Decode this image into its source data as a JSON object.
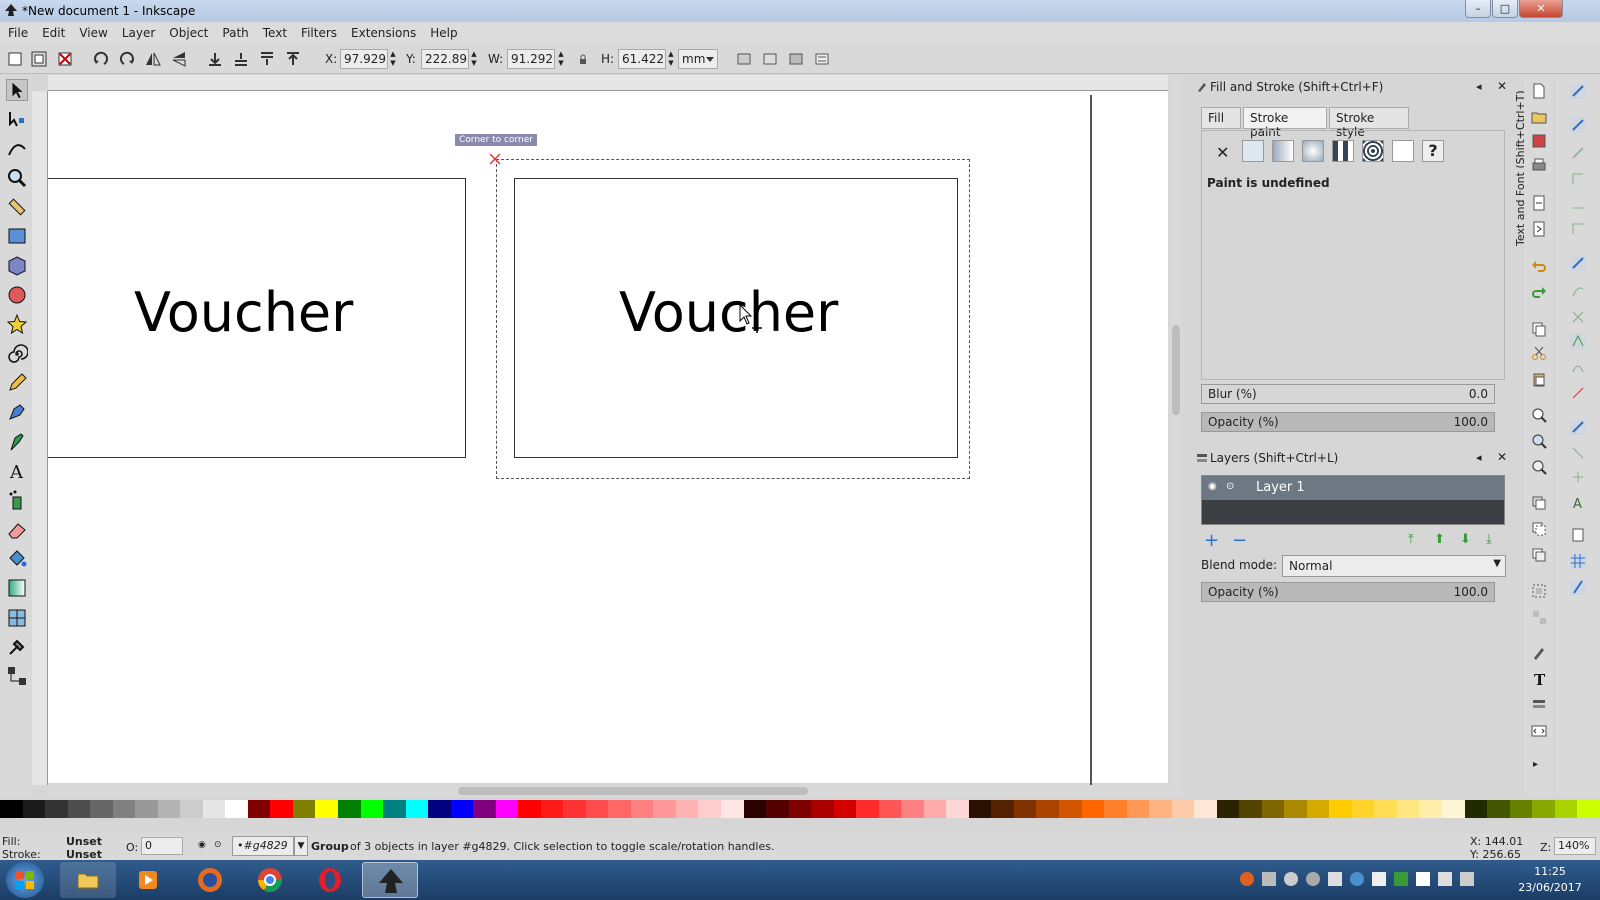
{
  "window": {
    "title": "*New document 1 - Inkscape",
    "minimize": "–",
    "maximize": "□",
    "close": "✕"
  },
  "menu": [
    "File",
    "Edit",
    "View",
    "Layer",
    "Object",
    "Path",
    "Text",
    "Filters",
    "Extensions",
    "Help"
  ],
  "toolbar": {
    "x_label": "X:",
    "x_value": "97.929",
    "y_label": "Y:",
    "y_value": "222.895",
    "w_label": "W:",
    "w_value": "91.292",
    "h_label": "H:",
    "h_value": "61.422",
    "unit": "mm"
  },
  "canvas": {
    "snap_tooltip": "Corner to corner",
    "left_card_text": "Voucher",
    "right_card_text": "Voucher"
  },
  "fill_stroke": {
    "title": "Fill and Stroke (Shift+Ctrl+F)",
    "tabs": [
      "Fill",
      "Stroke paint",
      "Stroke style"
    ],
    "paint_status": "Paint is undefined",
    "blur_label": "Blur (%)",
    "blur_value": "0.0",
    "opacity_label": "Opacity (%)",
    "opacity_value": "100.0",
    "vertical_tab": "Text and Font (Shift+Ctrl+T)"
  },
  "layers": {
    "title": "Layers (Shift+Ctrl+L)",
    "layer_name": "Layer 1",
    "blend_label": "Blend mode:",
    "blend_value": "Normal",
    "opacity_label": "Opacity (%)",
    "opacity_value": "100.0"
  },
  "status": {
    "fill_label": "Fill:",
    "fill_value": "Unset",
    "stroke_label": "Stroke:",
    "stroke_value": "Unset",
    "o_label": "O:",
    "o_value": "0",
    "layer_id": "•#g4829",
    "message_bold": "Group",
    "message": " of 3 objects in layer #g4829. Click selection to toggle scale/rotation handles.",
    "x_coord": "X: 144.01",
    "y_coord": "Y: 256.65",
    "z_label": "Z:",
    "zoom": "140%"
  },
  "taskbar": {
    "time": "11:25",
    "date": "23/06/2017"
  },
  "palette_colors": [
    "#000000",
    "#1a1a1a",
    "#333333",
    "#4d4d4d",
    "#666666",
    "#808080",
    "#999999",
    "#b3b3b3",
    "#cccccc",
    "#e6e6e6",
    "#ffffff",
    "#800000",
    "#ff0000",
    "#808000",
    "#ffff00",
    "#008000",
    "#00ff00",
    "#008080",
    "#00ffff",
    "#000080",
    "#0000ff",
    "#800080",
    "#ff00ff",
    "#ff0000",
    "#ff1a1a",
    "#ff3333",
    "#ff4d4d",
    "#ff6666",
    "#ff8080",
    "#ff9999",
    "#ffb3b3",
    "#ffcccc",
    "#ffe6e6",
    "#2b0000",
    "#550000",
    "#800000",
    "#aa0000",
    "#d40000",
    "#ff2a2a",
    "#ff5555",
    "#ff8080",
    "#ffaaaa",
    "#ffd5d5",
    "#2b1100",
    "#552200",
    "#803300",
    "#aa4400",
    "#d45500",
    "#ff6600",
    "#ff7f2a",
    "#ff9955",
    "#ffb380",
    "#ffccaa",
    "#ffe6d5",
    "#2b2200",
    "#554400",
    "#806600",
    "#aa8800",
    "#d4aa00",
    "#ffcc00",
    "#ffd42a",
    "#ffdd55",
    "#ffe680",
    "#ffeeaa",
    "#fff6d5",
    "#222b00",
    "#445500",
    "#668000",
    "#88aa00",
    "#aad400",
    "#ccff00"
  ]
}
